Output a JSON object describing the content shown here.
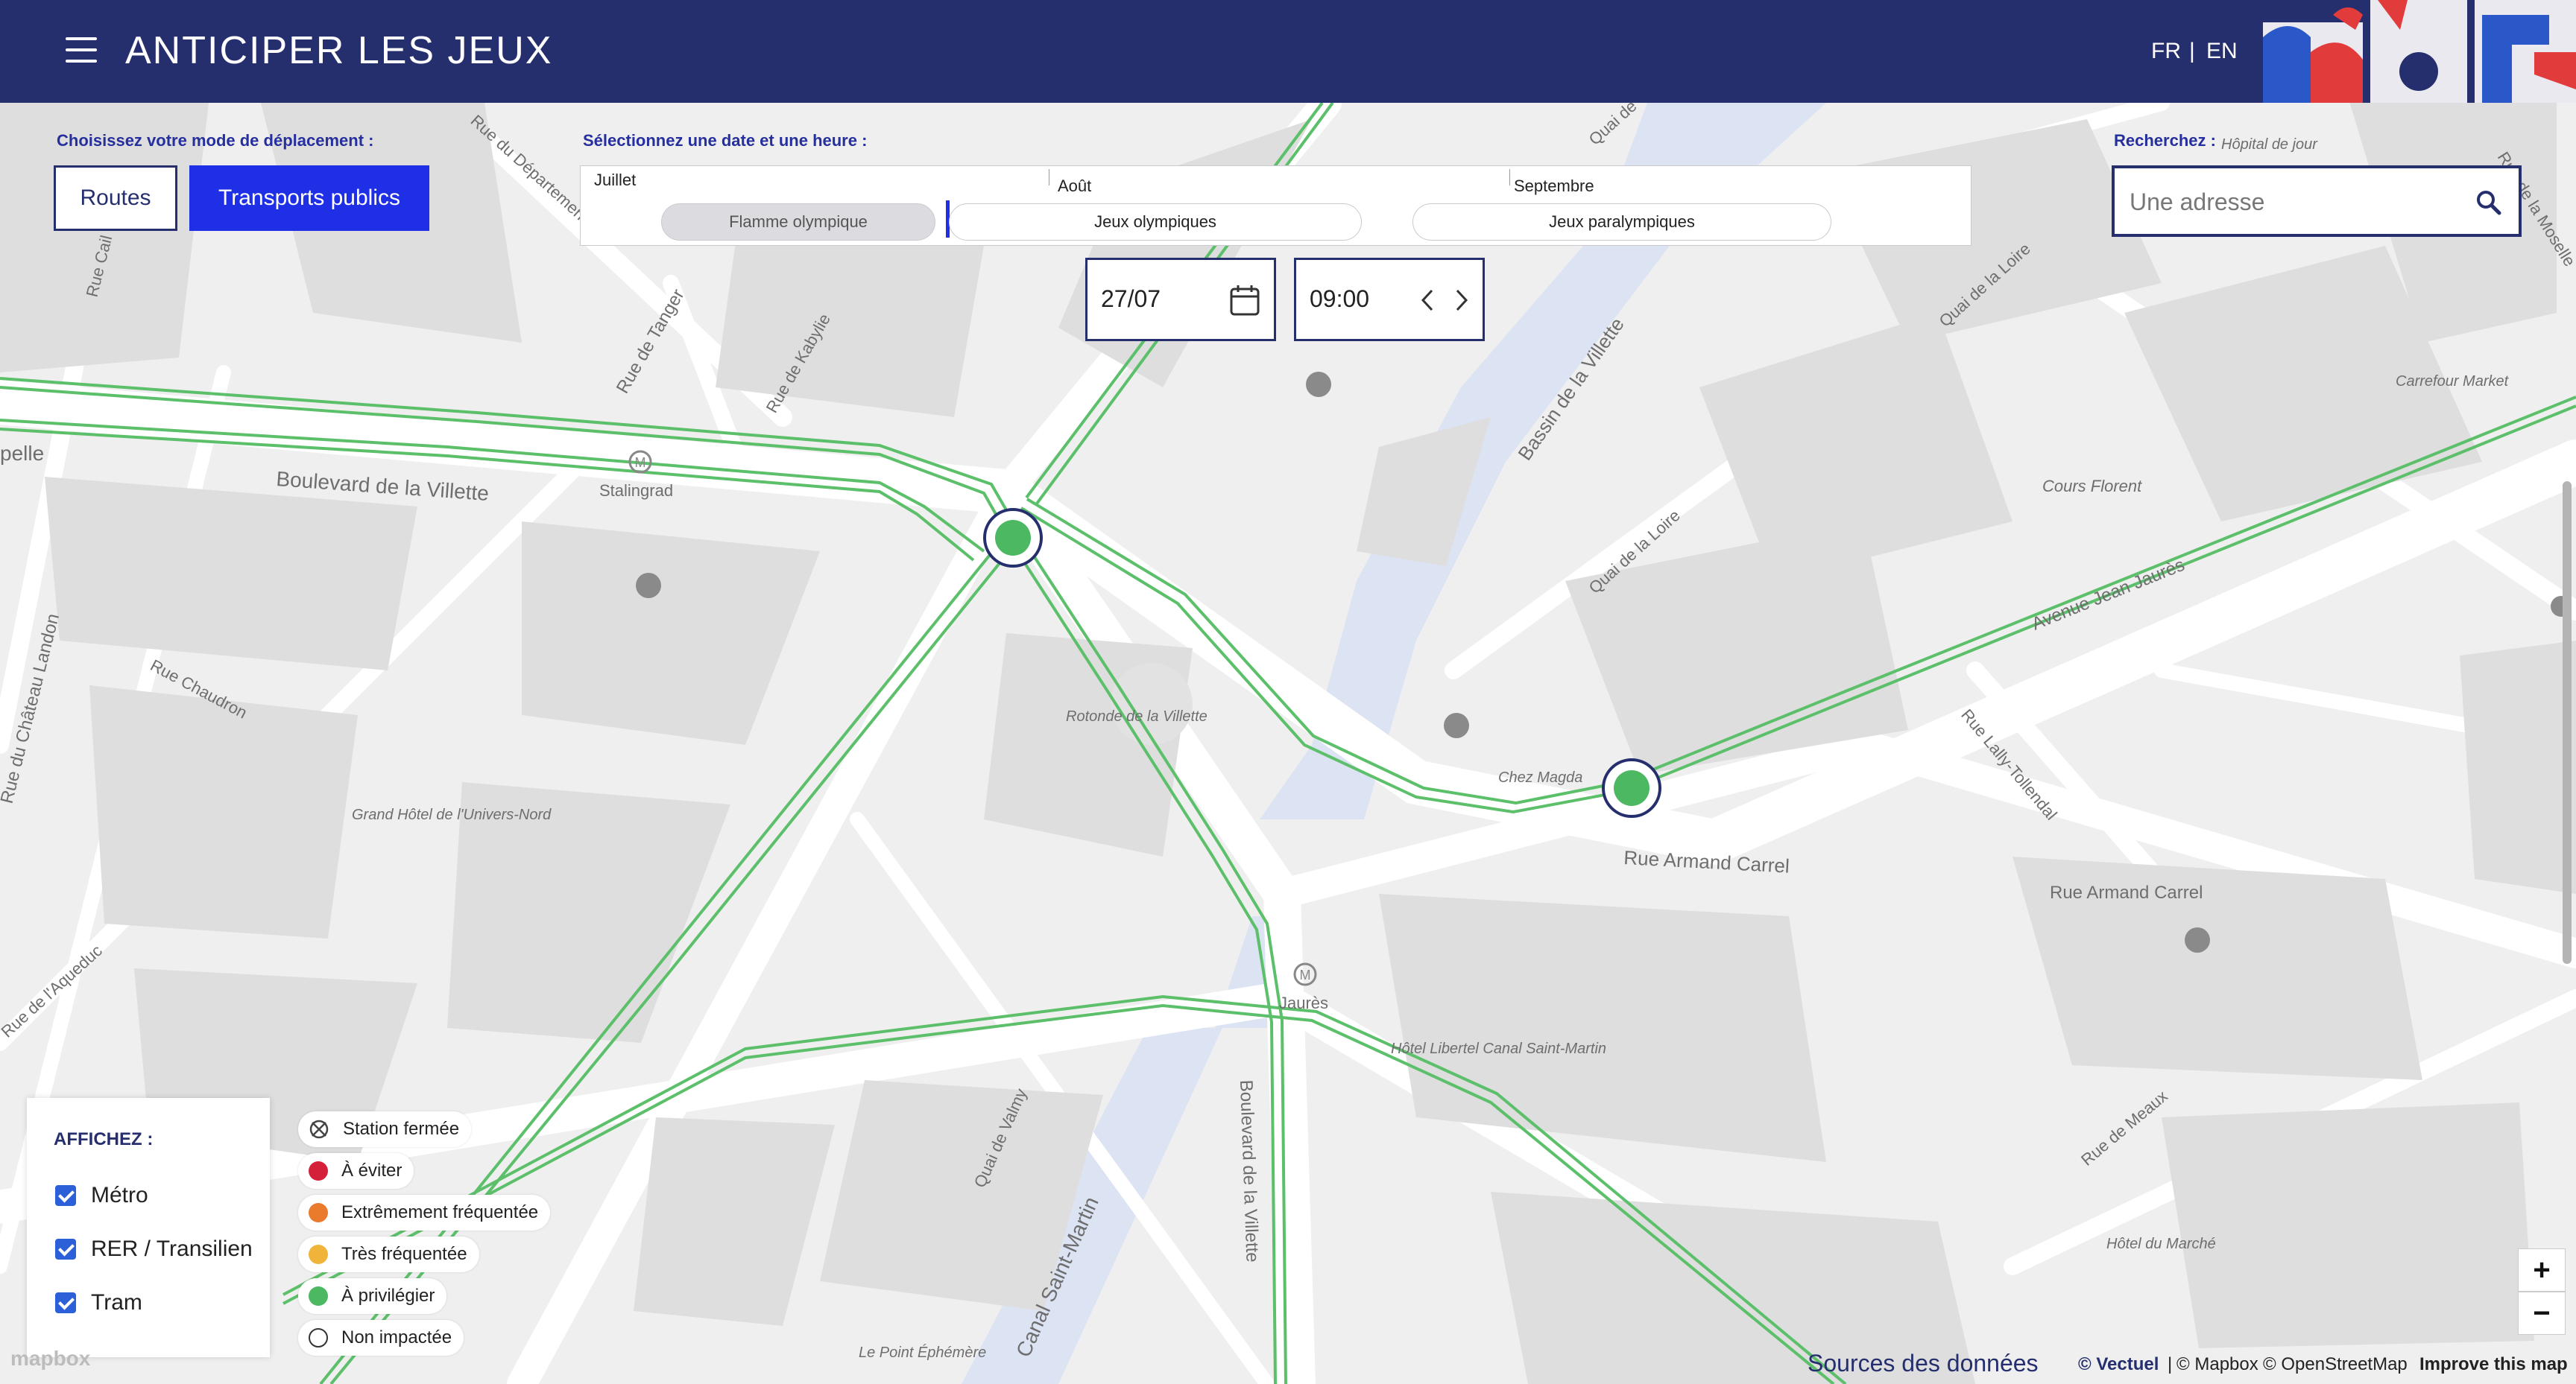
{
  "header": {
    "title": "ANTICIPER LES JEUX",
    "lang_fr": "FR",
    "lang_sep": "|",
    "lang_en": "EN"
  },
  "mode": {
    "label": "Choisissez votre mode de déplacement :",
    "routes": "Routes",
    "transports": "Transports publics",
    "active": "Transports publics"
  },
  "timeline": {
    "label": "Sélectionnez une date et une heure :",
    "months": [
      "Juillet",
      "Août",
      "Septembre"
    ],
    "periods": [
      "Flamme olympique",
      "Jeux olympiques",
      "Jeux paralympiques"
    ]
  },
  "date_value": "27/07",
  "time_value": "09:00",
  "search": {
    "label": "Recherchez :",
    "placeholder": "Une adresse"
  },
  "display": {
    "title": "AFFICHEZ :",
    "items": [
      {
        "label": "Métro",
        "checked": true
      },
      {
        "label": "RER / Transilien",
        "checked": true
      },
      {
        "label": "Tram",
        "checked": true
      }
    ]
  },
  "status_legend": [
    {
      "label": "Station fermée",
      "color": "#444444"
    },
    {
      "label": "À éviter",
      "color": "#d5203a"
    },
    {
      "label": "Extrêmement fréquentée",
      "color": "#ea7a2c"
    },
    {
      "label": "Très fréquentée",
      "color": "#f0b43a"
    },
    {
      "label": "À privilégier",
      "color": "#4cb862"
    },
    {
      "label": "Non impactée",
      "color": "#ffffff"
    }
  ],
  "map": {
    "line_color": "#5cbf6a",
    "labels": {
      "bd_villette": "Boulevard de la Villette",
      "stalingrad": "Stalingrad",
      "rue_tanger": "Rue de Tanger",
      "rue_kabylie": "Rue de Kabylie",
      "rue_chaudron": "Rue Chaudron",
      "rue_chateau_landon": "Rue du Château Landon",
      "grand_hotel": "Grand Hôtel de l'Univers-Nord",
      "rotonde": "Rotonde de la Villette",
      "bassin": "Bassin de la Villette",
      "quai_loire": "Quai de la Loire",
      "quai_loire2": "Quai de la Loire",
      "cours_florent": "Cours Florent",
      "carrefour_market": "Carrefour Market",
      "avenue_jean_jaures": "Avenue Jean Jaurès",
      "rue_lally": "Rue Lally-Tollendal",
      "chez_magda": "Chez Magda",
      "rue_armand_carrel": "Rue Armand Carrel",
      "rue_armand_carrel2": "Rue Armand Carrel",
      "jaures": "Jaurès",
      "hotel_libertel": "Hôtel Libertel Canal Saint-Martin",
      "quai_valmy": "Quai de Valmy",
      "canal_st_martin": "Canal Saint-Martin",
      "bd_villette2": "Boulevard de la Villette",
      "rue_meaux": "Rue de Meaux",
      "hotel_marche": "Hôtel du Marché",
      "point_ephemere": "Le Point Éphémère",
      "rue_aqueduc": "Rue de l'Aqueduc",
      "rue_departement": "Rue du Département",
      "rue_cail": "Rue Cail",
      "hopital": "Hôpital de jour",
      "rue_moselle": "Rue de la Moselle",
      "quai_seine": "Quai de Seine",
      "pelle": "pelle"
    }
  },
  "attribution": {
    "mapbox_logo": "mapbox",
    "sources": "Sources des données",
    "vectuel": "© Vectuel",
    "sep": "|",
    "mapbox": "© Mapbox",
    "osm": "© OpenStreetMap",
    "improve": "Improve this map"
  },
  "zoom": {
    "in": "+",
    "out": "−"
  }
}
